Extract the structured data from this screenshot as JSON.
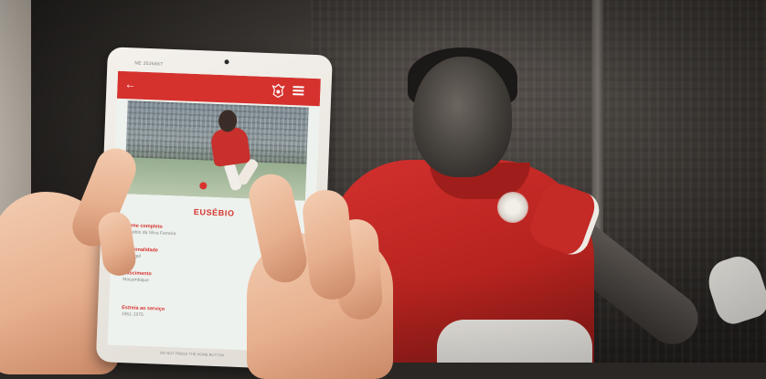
{
  "tablet": {
    "model_label": "NE 3526467",
    "home_caption": "DO NOT PRESS THE HOME BUTTON"
  },
  "app": {
    "back_icon": "back-arrow-icon",
    "logo_icon": "club-crest-icon",
    "menu_icon": "hamburger-menu-icon",
    "accent_color": "#d5322e"
  },
  "player": {
    "name": "EUSÉBIO",
    "fields": [
      {
        "label": "Nome completo",
        "value": "Eusébio da Silva Ferreira"
      },
      {
        "label": "Nacionalidade",
        "value": "Portugal"
      },
      {
        "label": "Nascimento",
        "value": "Moçambique"
      },
      {
        "label": "Estreia ao serviço",
        "value": "1961-1975"
      }
    ]
  }
}
